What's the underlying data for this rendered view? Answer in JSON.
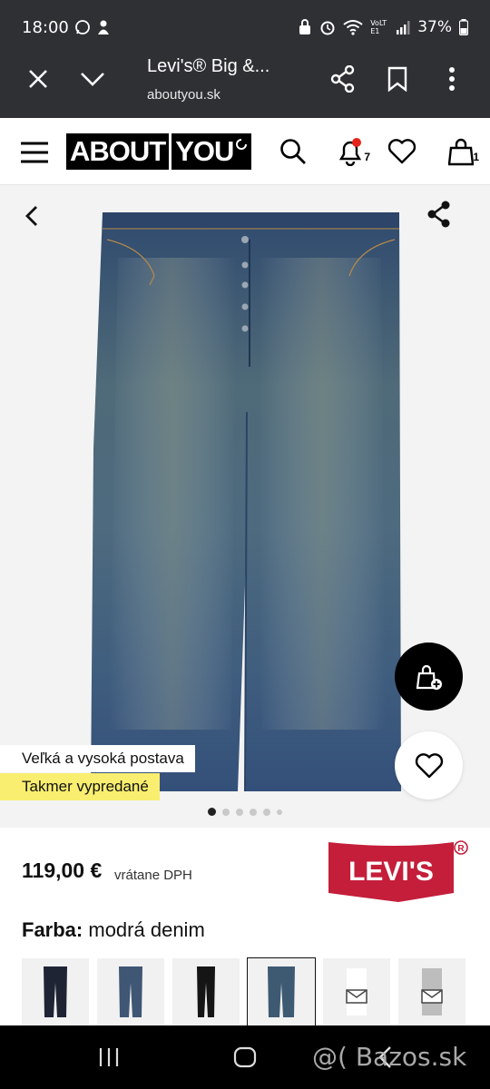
{
  "status_bar": {
    "time": "18:00",
    "battery": "37%",
    "network_label": "VoLTE1"
  },
  "browser": {
    "page_title": "Levi's® Big &...",
    "url": "aboutyou.sk"
  },
  "site_header": {
    "logo_left": "ABOUT",
    "logo_right": "YOU",
    "notifications_count": "7",
    "cart_count": "1"
  },
  "gallery": {
    "tag_fit": "Veľká a vysoká postava",
    "tag_stock": "Takmer vypredané",
    "image_count": 6,
    "active_image_index": 0
  },
  "product": {
    "price": "119,00 €",
    "price_note": "vrátane DPH",
    "brand_logo_text": "LEVI'S",
    "color_label": "Farba:",
    "color_value": "modrá denim",
    "swatches": [
      {
        "name": "dark-indigo",
        "color": "#1f2434"
      },
      {
        "name": "mid-blue",
        "color": "#3f5675"
      },
      {
        "name": "black",
        "color": "#151515"
      },
      {
        "name": "vintage-blue",
        "color": "#3e5a72",
        "selected": true
      },
      {
        "name": "white-placeholder",
        "color": "#f0f0f0"
      },
      {
        "name": "grey-placeholder",
        "color": "#bdbdbd"
      }
    ]
  },
  "watermark": "@( Bazos.sk",
  "colors": {
    "dark_bar": "#2f3034",
    "brand_black": "#000000",
    "tag_yellow": "#f9ee6f",
    "levis_red": "#c41e3a",
    "denim": "#3d5878"
  }
}
